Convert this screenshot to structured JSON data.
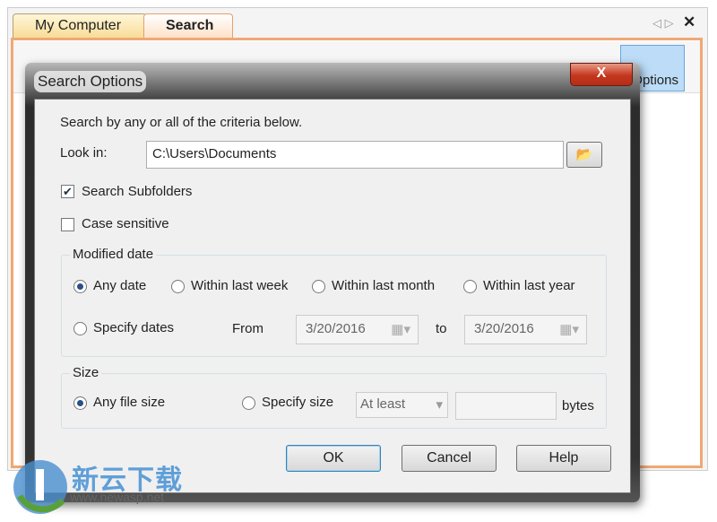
{
  "tabs": [
    {
      "label": "My Computer"
    },
    {
      "label": "Search"
    }
  ],
  "toolbar": {
    "options_label": "Options",
    "nav": "◁ ▷",
    "close": "✕"
  },
  "dialog": {
    "title": "Search Options",
    "close": "X",
    "intro": "Search by any or all of the criteria below.",
    "look_in_label": "Look in:",
    "look_in_value": "C:\\Users\\Documents",
    "search_subfolders": {
      "label": "Search Subfolders",
      "checked": true
    },
    "case_sensitive": {
      "label": "Case sensitive",
      "checked": false
    },
    "modified": {
      "legend": "Modified date",
      "options": [
        "Any date",
        "Within last week",
        "Within last month",
        "Within last year",
        "Specify dates"
      ],
      "selected": "Any date",
      "from_label": "From",
      "from_value": "3/20/2016",
      "to_label": "to",
      "to_value": "3/20/2016"
    },
    "size": {
      "legend": "Size",
      "options": [
        "Any file size",
        "Specify size"
      ],
      "selected": "Any file size",
      "comparison": "At least",
      "value": "",
      "unit": "bytes"
    },
    "buttons": {
      "ok": "OK",
      "cancel": "Cancel",
      "help": "Help"
    }
  },
  "watermark": {
    "text": "新云下载",
    "url": "www.newasp.net"
  }
}
